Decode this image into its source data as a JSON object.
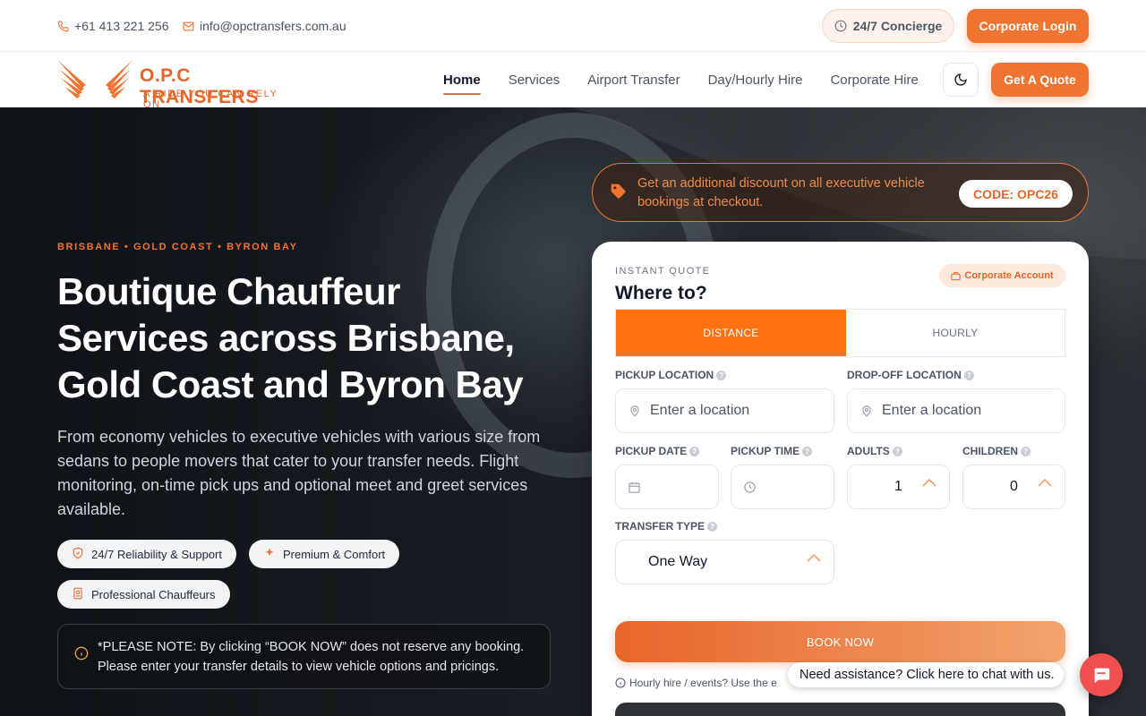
{
  "topbar": {
    "phone": "+61 413 221 256",
    "email": "info@opctransfers.com.au",
    "concierge": "24/7 Concierge",
    "corporate_login": "Corporate Login"
  },
  "brand": {
    "name": "O.P.C TRANSFERS",
    "tagline": "A RIDE YOU CAN RELY ON",
    "accent": "#ef7432"
  },
  "nav": {
    "items": [
      {
        "label": "Home",
        "active": true
      },
      {
        "label": "Services"
      },
      {
        "label": "Airport Transfer"
      },
      {
        "label": "Day/Hourly Hire"
      },
      {
        "label": "Corporate Hire"
      }
    ],
    "theme_icon": "moon-icon",
    "quote_button": "Get A Quote"
  },
  "hero": {
    "eyebrow": "BRISBANE • GOLD COAST • BYRON BAY",
    "headline": "Boutique Chauffeur Services across Brisbane, Gold Coast and Byron Bay",
    "description": "From economy vehicles to executive vehicles with various size from sedans to people movers that cater to your transfer needs. Flight monitoring, on-time pick ups and optional meet and greet services available.",
    "features": [
      {
        "label": "24/7 Reliability & Support",
        "icon": "shield-icon"
      },
      {
        "label": "Premium & Comfort",
        "icon": "sparkle-icon"
      },
      {
        "label": "Professional Chauffeurs",
        "icon": "badge-icon"
      }
    ],
    "notice": "*PLEASE NOTE: By clicking “BOOK NOW” does not reserve any booking. Please enter your transfer details to view vehicle options and pricings."
  },
  "promo": {
    "text": "Get an additional discount on all executive vehicle bookings at checkout.",
    "code": "CODE: OPC26"
  },
  "quote": {
    "eyebrow": "INSTANT QUOTE",
    "title": "Where to?",
    "corporate_account": "Corporate Account",
    "tabs": [
      {
        "label": "DISTANCE",
        "active": true
      },
      {
        "label": "HOURLY"
      }
    ],
    "pickup_location": {
      "label": "PICKUP LOCATION",
      "placeholder": "Enter a location"
    },
    "dropoff_location": {
      "label": "DROP-OFF LOCATION",
      "placeholder": "Enter a location"
    },
    "pickup_date": {
      "label": "PICKUP DATE"
    },
    "pickup_time": {
      "label": "PICKUP TIME"
    },
    "adults": {
      "label": "ADULTS",
      "value": "1"
    },
    "children": {
      "label": "CHILDREN",
      "value": "0"
    },
    "transfer_type": {
      "label": "TRANSFER TYPE",
      "value": "One Way"
    },
    "book_now": "BOOK NOW",
    "hourly_note": "Hourly hire / events? Use the e"
  },
  "chat": {
    "prompt": "Need assistance? Click here to chat with us."
  }
}
